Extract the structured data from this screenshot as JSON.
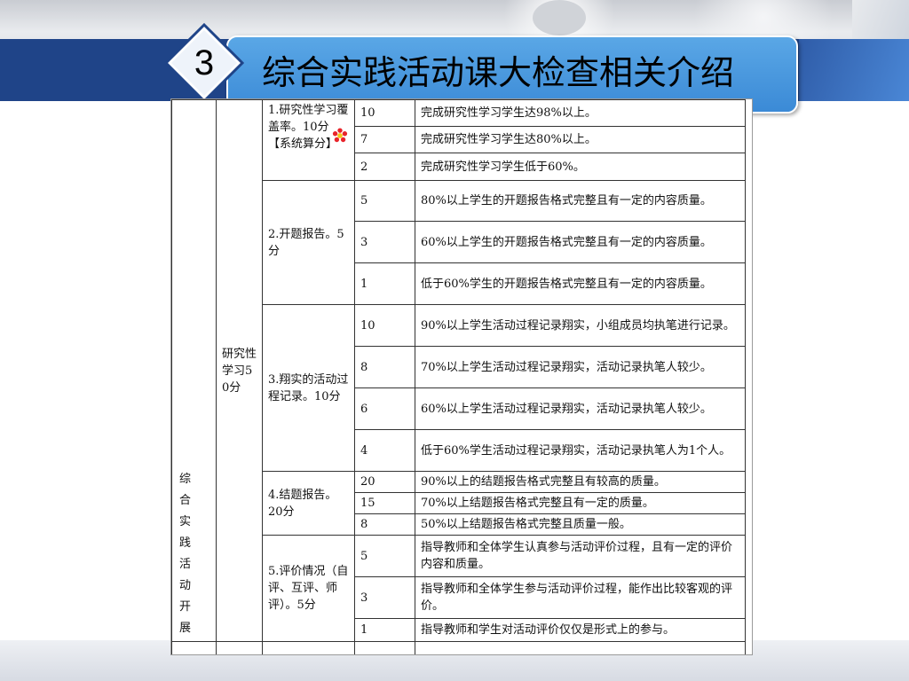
{
  "slide": {
    "section_number": "3",
    "title": "综合实践活动课大检查相关介绍",
    "colors": {
      "band": "#1f4488",
      "title_box": "#4a98df",
      "accent_flower": "#e8242b"
    }
  },
  "table": {
    "category": "综合实践活动开展",
    "category_chars": [
      "综",
      "合",
      "实",
      "践",
      "活",
      "动",
      "开",
      "展"
    ],
    "subcategory": "研究性学习50分",
    "items": [
      {
        "label": "1.研究性学习覆盖率。10分【系统算分】",
        "criteria": [
          {
            "score": "10",
            "desc": "完成研究性学习学生达98%以上。"
          },
          {
            "score": "7",
            "desc": "完成研究性学习学生达80%以上。"
          },
          {
            "score": "2",
            "desc": "完成研究性学习学生低于60%。"
          }
        ]
      },
      {
        "label": "2.开题报告。5分",
        "criteria": [
          {
            "score": "5",
            "desc": "80%以上学生的开题报告格式完整且有一定的内容质量。"
          },
          {
            "score": "3",
            "desc": "60%以上学生的开题报告格式完整且有一定的内容质量。"
          },
          {
            "score": "1",
            "desc": "低于60%学生的开题报告格式完整且有一定的内容质量。"
          }
        ]
      },
      {
        "label": "3.翔实的活动过程记录。10分",
        "criteria": [
          {
            "score": "10",
            "desc": "90%以上学生活动过程记录翔实，小组成员均执笔进行记录。"
          },
          {
            "score": "8",
            "desc": "70%以上学生活动过程记录翔实，活动记录执笔人较少。"
          },
          {
            "score": "6",
            "desc": "60%以上学生活动过程记录翔实，活动记录执笔人较少。"
          },
          {
            "score": "4",
            "desc": "低于60%学生活动过程记录翔实，活动记录执笔人为1个人。"
          }
        ]
      },
      {
        "label": "4.结题报告。20分",
        "criteria": [
          {
            "score": "20",
            "desc": "90%以上的结题报告格式完整且有较高的质量。"
          },
          {
            "score": "15",
            "desc": "70%以上结题报告格式完整且有一定的质量。"
          },
          {
            "score": "8",
            "desc": "50%以上结题报告格式完整且质量一般。"
          }
        ]
      },
      {
        "label": "5.评价情况（自评、互评、师评）。5分",
        "criteria": [
          {
            "score": "5",
            "desc": "指导教师和全体学生认真参与活动评价过程，且有一定的评价内容和质量。"
          },
          {
            "score": "3",
            "desc": "指导教师和全体学生参与活动评价过程，能作出比较客观的评价。"
          },
          {
            "score": "1",
            "desc": "指导教师和学生对活动评价仅仅是形式上的参与。"
          }
        ]
      }
    ]
  }
}
